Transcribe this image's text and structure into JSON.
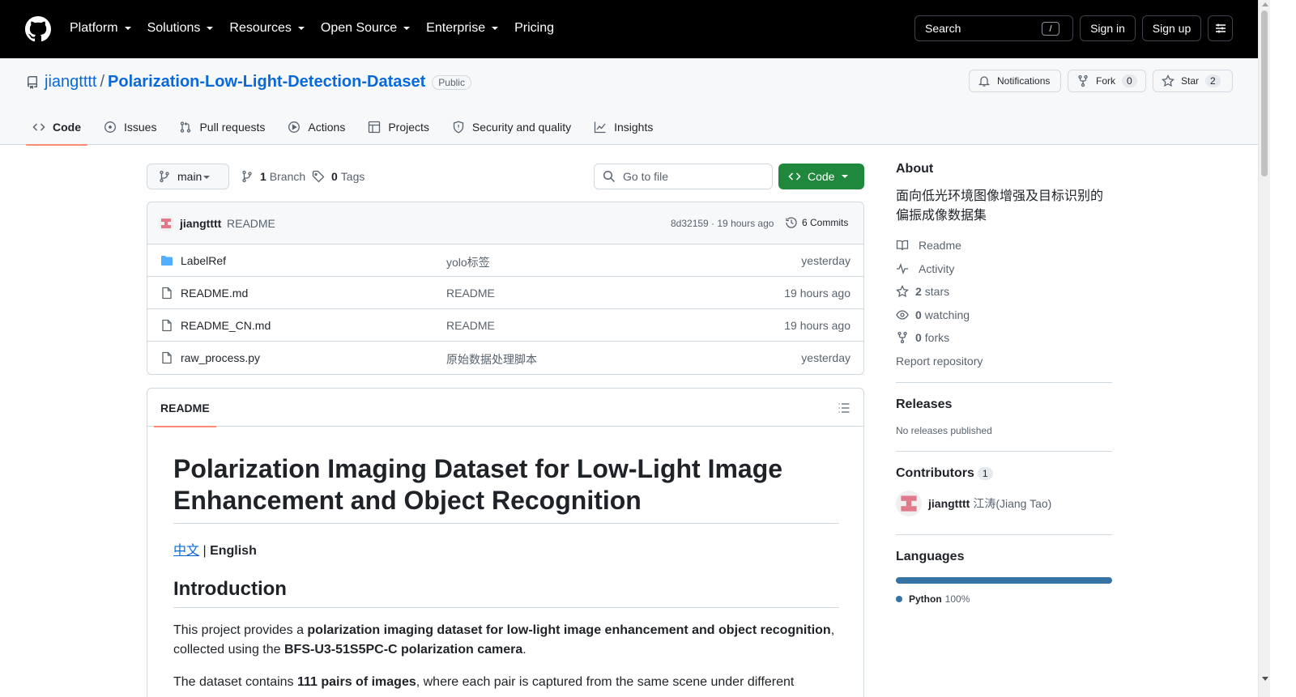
{
  "header": {
    "nav": [
      {
        "label": "Platform",
        "has_menu": true
      },
      {
        "label": "Solutions",
        "has_menu": true
      },
      {
        "label": "Resources",
        "has_menu": true
      },
      {
        "label": "Open Source",
        "has_menu": true
      },
      {
        "label": "Enterprise",
        "has_menu": true
      },
      {
        "label": "Pricing",
        "has_menu": false
      }
    ],
    "search_label": "Search",
    "search_shortcut": "/",
    "signin_label": "Sign in",
    "signup_label": "Sign up"
  },
  "repo": {
    "owner": "jiangtttt",
    "separator": "/",
    "name": "Polarization-Low-Light-Detection-Dataset",
    "visibility": "Public",
    "notifications_label": "Notifications",
    "fork_label": "Fork",
    "fork_count": "0",
    "star_label": "Star",
    "star_count": "2"
  },
  "tabs": [
    {
      "label": "Code",
      "icon": "code-icon",
      "selected": true
    },
    {
      "label": "Issues",
      "icon": "issue-icon"
    },
    {
      "label": "Pull requests",
      "icon": "pull-request-icon"
    },
    {
      "label": "Actions",
      "icon": "play-icon"
    },
    {
      "label": "Projects",
      "icon": "table-icon"
    },
    {
      "label": "Security and quality",
      "icon": "shield-icon"
    },
    {
      "label": "Insights",
      "icon": "graph-icon"
    }
  ],
  "toolbar": {
    "branch": "main",
    "branch_count": "1",
    "branch_label": "Branch",
    "tag_count": "0",
    "tag_label": "Tags",
    "goto_placeholder": "Go to file",
    "code_button": "Code"
  },
  "commit": {
    "author": "jiangtttt",
    "message": "README",
    "sha_time": "8d32159 · 19 hours ago",
    "commits_label": "6 Commits"
  },
  "files": [
    {
      "name": "LabelRef",
      "type": "folder",
      "message": "yolo标签",
      "date": "yesterday"
    },
    {
      "name": "README.md",
      "type": "file",
      "message": "README",
      "date": "19 hours ago"
    },
    {
      "name": "README_CN.md",
      "type": "file",
      "message": "README",
      "date": "19 hours ago"
    },
    {
      "name": "raw_process.py",
      "type": "file",
      "message": "原始数据处理脚本",
      "date": "yesterday"
    }
  ],
  "readme": {
    "tab_label": "README",
    "title": "Polarization Imaging Dataset for Low-Light Image Enhancement and Object Recognition",
    "lang_link": "中文",
    "lang_sep": " | ",
    "lang_current": "English",
    "intro_heading": "Introduction",
    "p1_a": "This project provides a ",
    "p1_b": "polarization imaging dataset for low-light image enhancement and object recognition",
    "p1_c": ", collected using the ",
    "p1_d": "BFS-U3-51S5PC-C polarization camera",
    "p1_e": ".",
    "p2_a": "The dataset contains ",
    "p2_b": "111 pairs of images",
    "p2_c": ", where each pair is captured from the same scene under different"
  },
  "sidebar": {
    "about_title": "About",
    "description": "面向低光环境图像增强及目标识别的偏振成像数据集",
    "links": [
      {
        "icon": "book-icon",
        "label": "Readme",
        "bold": ""
      },
      {
        "icon": "pulse-icon",
        "label": "Activity",
        "bold": ""
      },
      {
        "icon": "star-icon",
        "label": "stars",
        "bold": "2"
      },
      {
        "icon": "eye-icon",
        "label": "watching",
        "bold": "0"
      },
      {
        "icon": "fork-icon",
        "label": "forks",
        "bold": "0"
      }
    ],
    "report": "Report repository",
    "releases_title": "Releases",
    "releases_empty": "No releases published",
    "contributors_title": "Contributors",
    "contributors_count": "1",
    "contributor_login": "jiangtttt",
    "contributor_name": "江涛(Jiang Tao)",
    "languages_title": "Languages",
    "language_name": "Python",
    "language_pct": "100%",
    "language_fraction": 1.0,
    "language_color": "#3572A5"
  }
}
